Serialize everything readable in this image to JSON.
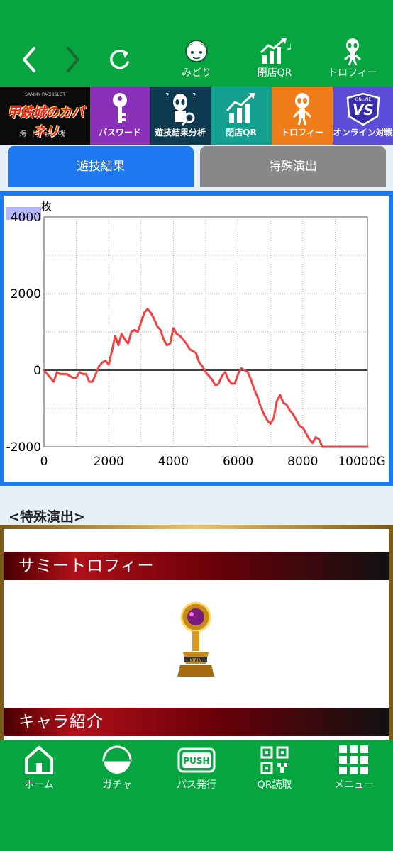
{
  "topbar": {
    "back_icon": "chevron-left-icon",
    "forward_icon": "chevron-right-icon",
    "reload_icon": "reload-icon",
    "items": [
      {
        "label": "みどり",
        "icon": "character-icon"
      },
      {
        "label": "閉店QR",
        "icon": "chart-up-icon"
      },
      {
        "label": "トロフィー",
        "icon": "alien-icon"
      }
    ]
  },
  "tiles": {
    "logo_top": "SAMMY PACHISLOT",
    "logo_main": "甲鉄城のカバネリ",
    "logo_sub": "海門決戦",
    "items": [
      {
        "label": "パスワード",
        "color": "#8a2fb8"
      },
      {
        "label": "遊技結果分析",
        "color": "#0e3a50"
      },
      {
        "label": "閉店QR",
        "color": "#13a08f"
      },
      {
        "label": "トロフィー",
        "color": "#ef7d1a"
      },
      {
        "label": "オンライン対戦",
        "color": "#5b4dd8"
      }
    ]
  },
  "tabs": {
    "active": "遊技結果",
    "inactive": "特殊演出"
  },
  "chart_data": {
    "type": "line",
    "ylabel": "枚",
    "x_unit_label": "10000G",
    "ylim": [
      -2000,
      4000
    ],
    "xlim": [
      0,
      10000
    ],
    "y_ticks": [
      "4000",
      "2000",
      "0",
      "-2000"
    ],
    "x_ticks": [
      "0",
      "2000",
      "4000",
      "6000",
      "8000",
      "10000G"
    ],
    "grid": true,
    "series": [
      {
        "color": "#ee4444",
        "x": [
          0,
          150,
          300,
          400,
          500,
          700,
          900,
          1000,
          1100,
          1200,
          1300,
          1400,
          1500,
          1600,
          1700,
          1800,
          1900,
          2000,
          2100,
          2200,
          2300,
          2400,
          2500,
          2600,
          2700,
          2800,
          2900,
          3000,
          3100,
          3200,
          3300,
          3400,
          3500,
          3600,
          3700,
          3800,
          3900,
          4000,
          4100,
          4200,
          4300,
          4400,
          4500,
          4600,
          4700,
          4800,
          4900,
          5000,
          5100,
          5200,
          5300,
          5400,
          5500,
          5600,
          5700,
          5800,
          5900,
          6000,
          6100,
          6200,
          6300,
          6400,
          6500,
          6600,
          6700,
          6800,
          6900,
          7000,
          7100,
          7200,
          7300,
          7400,
          7500,
          7600,
          7700,
          7800,
          7900,
          8000,
          8100,
          8200,
          8300,
          8400,
          8500,
          8600,
          8700,
          8800,
          8900,
          9000,
          9100,
          9200,
          9500,
          10000
        ],
        "y": [
          0,
          -150,
          -300,
          -50,
          -100,
          -100,
          -200,
          -200,
          -50,
          -100,
          -100,
          -300,
          -300,
          -100,
          100,
          200,
          250,
          150,
          500,
          900,
          650,
          950,
          800,
          700,
          1000,
          1050,
          1000,
          1250,
          1500,
          1600,
          1500,
          1350,
          1150,
          1050,
          800,
          650,
          700,
          1100,
          950,
          900,
          800,
          700,
          550,
          500,
          450,
          200,
          100,
          -50,
          -150,
          -250,
          -400,
          -350,
          -150,
          -50,
          -250,
          -350,
          -350,
          -100,
          50,
          0,
          -50,
          -250,
          -500,
          -700,
          -950,
          -1150,
          -1300,
          -1400,
          -1250,
          -800,
          -650,
          -850,
          -900,
          -1050,
          -1150,
          -1300,
          -1450,
          -1500,
          -1650,
          -1800,
          -1900,
          -1750,
          -1800,
          -2000,
          -2000,
          -2000,
          -2000,
          -2000,
          -2000,
          -2000,
          -2000,
          -2000
        ]
      }
    ]
  },
  "special": {
    "heading": "<特殊演出>",
    "bar1": "サミートロフィー",
    "bar2": "キャラ紹介",
    "trophy_icon": "gold-trophy-icon",
    "trophy_text": "KIRIN"
  },
  "bottomnav": [
    {
      "label": "ホーム",
      "icon": "home-icon"
    },
    {
      "label": "ガチャ",
      "icon": "gacha-icon"
    },
    {
      "label": "パス発行",
      "icon": "push-icon",
      "icon_text": "PUSH"
    },
    {
      "label": "QR読取",
      "icon": "qr-icon"
    },
    {
      "label": "メニュー",
      "icon": "menu-grid-icon"
    }
  ]
}
